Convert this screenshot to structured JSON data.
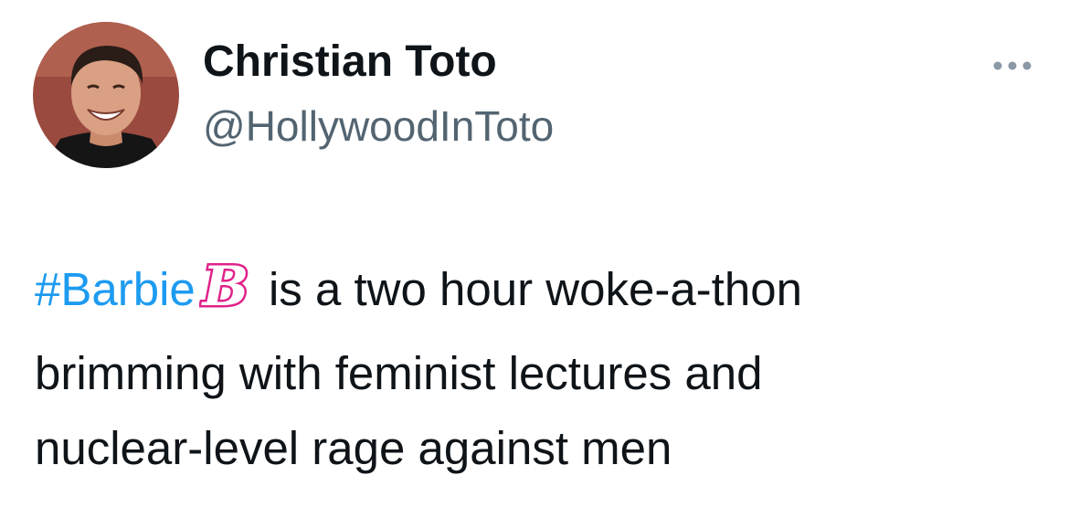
{
  "author": {
    "display_name": "Christian Toto",
    "handle": "@HollywoodInToto",
    "avatar_icon": "profile-photo"
  },
  "more_button": {
    "icon": "more-horizontal-icon",
    "color": "#536471"
  },
  "tweet": {
    "hashtag": "#Barbie",
    "emoji": "barbie-b-emoji",
    "emoji_color": "#e0218a",
    "lines": [
      " is a two hour woke-a-thon",
      "brimming with feminist lectures and",
      "nuclear-level rage against men"
    ]
  },
  "colors": {
    "text": "#0f1419",
    "secondary": "#536471",
    "link": "#1d9bf0",
    "background": "#ffffff"
  }
}
